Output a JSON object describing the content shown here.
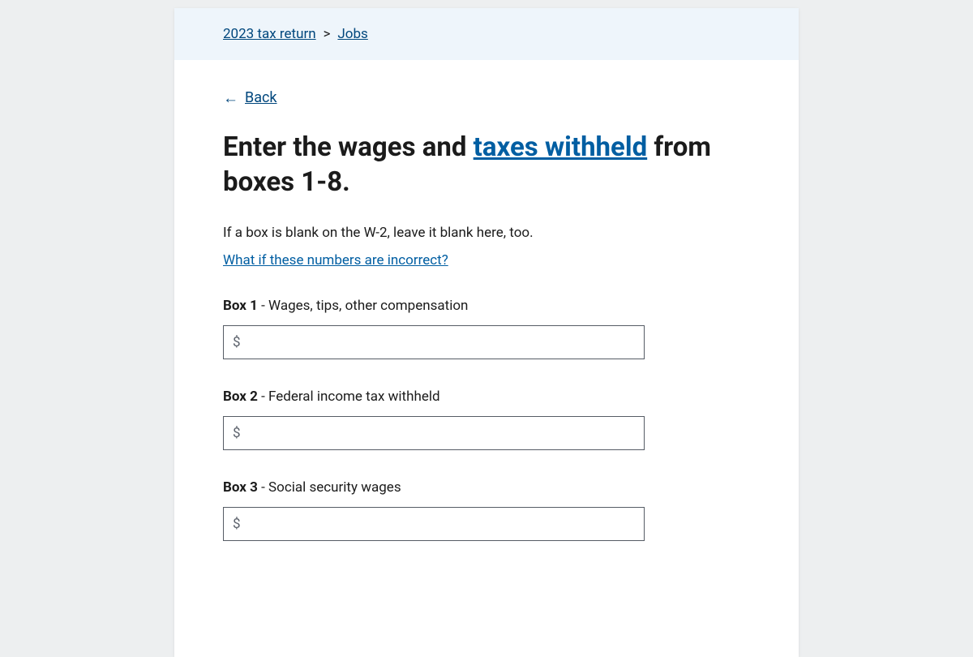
{
  "breadcrumb": {
    "item1": "2023 tax return",
    "sep": ">",
    "item2": "Jobs"
  },
  "back": {
    "arrow": "←",
    "label": "Back"
  },
  "heading": {
    "part1": "Enter the wages and ",
    "link": "taxes withheld",
    "part2": " from boxes 1-8."
  },
  "subtext": "If a box is blank on the W-2, leave it blank here, too.",
  "help_link": "What if these numbers are incorrect?",
  "currency_prefix": "$",
  "fields": {
    "box1": {
      "bold": "Box 1",
      "rest": " - Wages, tips, other compensation",
      "value": ""
    },
    "box2": {
      "bold": "Box 2",
      "rest": " - Federal income tax withheld",
      "value": ""
    },
    "box3": {
      "bold": "Box 3",
      "rest": " - Social security wages",
      "value": ""
    }
  }
}
